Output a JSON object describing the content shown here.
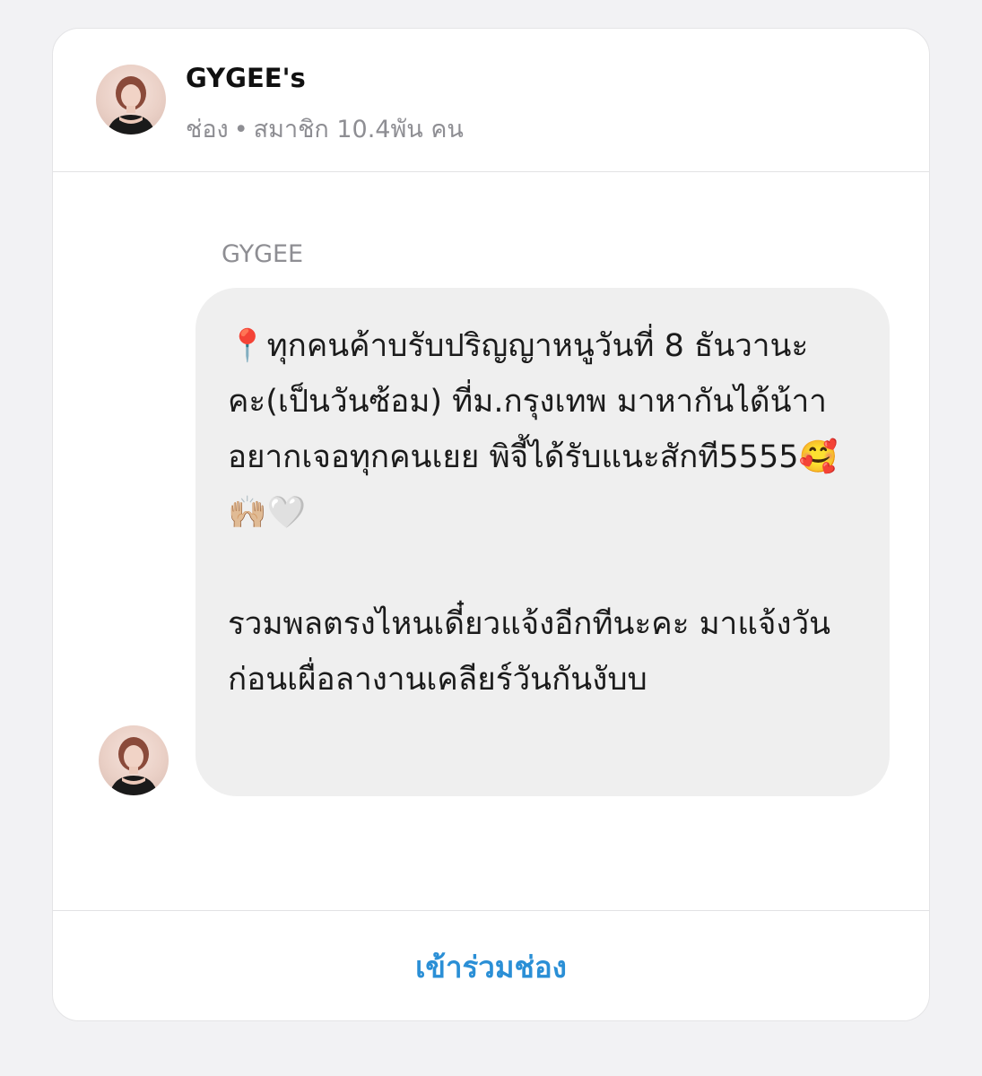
{
  "channel": {
    "name": "GYGEE's",
    "type_label": "ช่อง",
    "separator": "•",
    "members_label": "สมาชิก 10.4พัน คน"
  },
  "message": {
    "sender": "GYGEE",
    "text": "📍ทุกคนค้าบรับปริญญาหนูวันที่ 8 ธันวานะคะ(เป็นวันซ้อม) ที่ม.กรุงเทพ มาหากันได้น้าา อยากเจอทุกคนเยย พิจี้ได้รับแนะสักที5555🥰🙌🏼🤍\n\nรวมพลตรงไหนเดี๋ยวแจ้งอีกทีนะคะ มาแจ้งวันก่อนเผื่อลางานเคลียร์วันกันงับบ"
  },
  "actions": {
    "join_label": "เข้าร่วมช่อง"
  },
  "colors": {
    "accent": "#2a8fd6",
    "bubble": "#efefef",
    "meta_text": "#8e8e93"
  }
}
